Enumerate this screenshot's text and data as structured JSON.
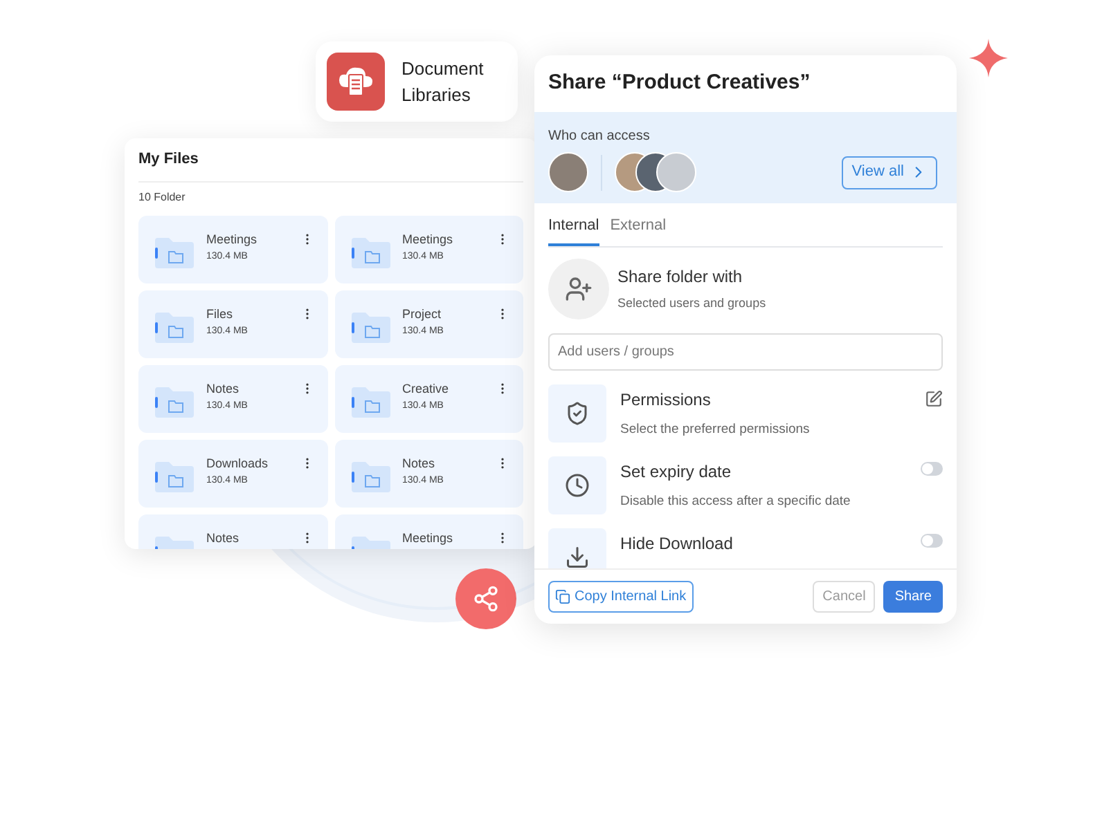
{
  "badge_card": {
    "title": "Document Libraries"
  },
  "my_files": {
    "title": "My Files",
    "count": "10 Folder",
    "folders": [
      {
        "name": "Meetings",
        "size": "130.4 MB"
      },
      {
        "name": "Meetings",
        "size": "130.4 MB"
      },
      {
        "name": "Files",
        "size": "130.4 MB"
      },
      {
        "name": "Project",
        "size": "130.4 MB"
      },
      {
        "name": "Notes",
        "size": "130.4 MB"
      },
      {
        "name": "Creative",
        "size": "130.4 MB"
      },
      {
        "name": "Downloads",
        "size": "130.4 MB"
      },
      {
        "name": "Notes",
        "size": "130.4 MB"
      },
      {
        "name": "Notes"
      },
      {
        "name": "Meetings"
      }
    ]
  },
  "share_dialog": {
    "title": "Share “Product Creatives”",
    "access_label": "Who can access",
    "view_all": "View all",
    "tabs": [
      {
        "label": "Internal",
        "selected": true
      },
      {
        "label": "External",
        "selected": false
      }
    ],
    "share_with": {
      "title": "Share folder with",
      "subtitle": "Selected users and groups"
    },
    "search": {
      "placeholder": "Add users / groups"
    },
    "options": [
      {
        "kind": "edit",
        "title": "Permissions",
        "subtitle": "Select the preferred permissions"
      },
      {
        "kind": "toggle",
        "title": "Set expiry date",
        "subtitle": "Disable this access after a specific date",
        "on": false
      },
      {
        "kind": "toggle",
        "title": "Hide Download",
        "on": false
      }
    ],
    "copy_link": "Copy Internal Link",
    "cancel": "Cancel",
    "share": "Share"
  }
}
